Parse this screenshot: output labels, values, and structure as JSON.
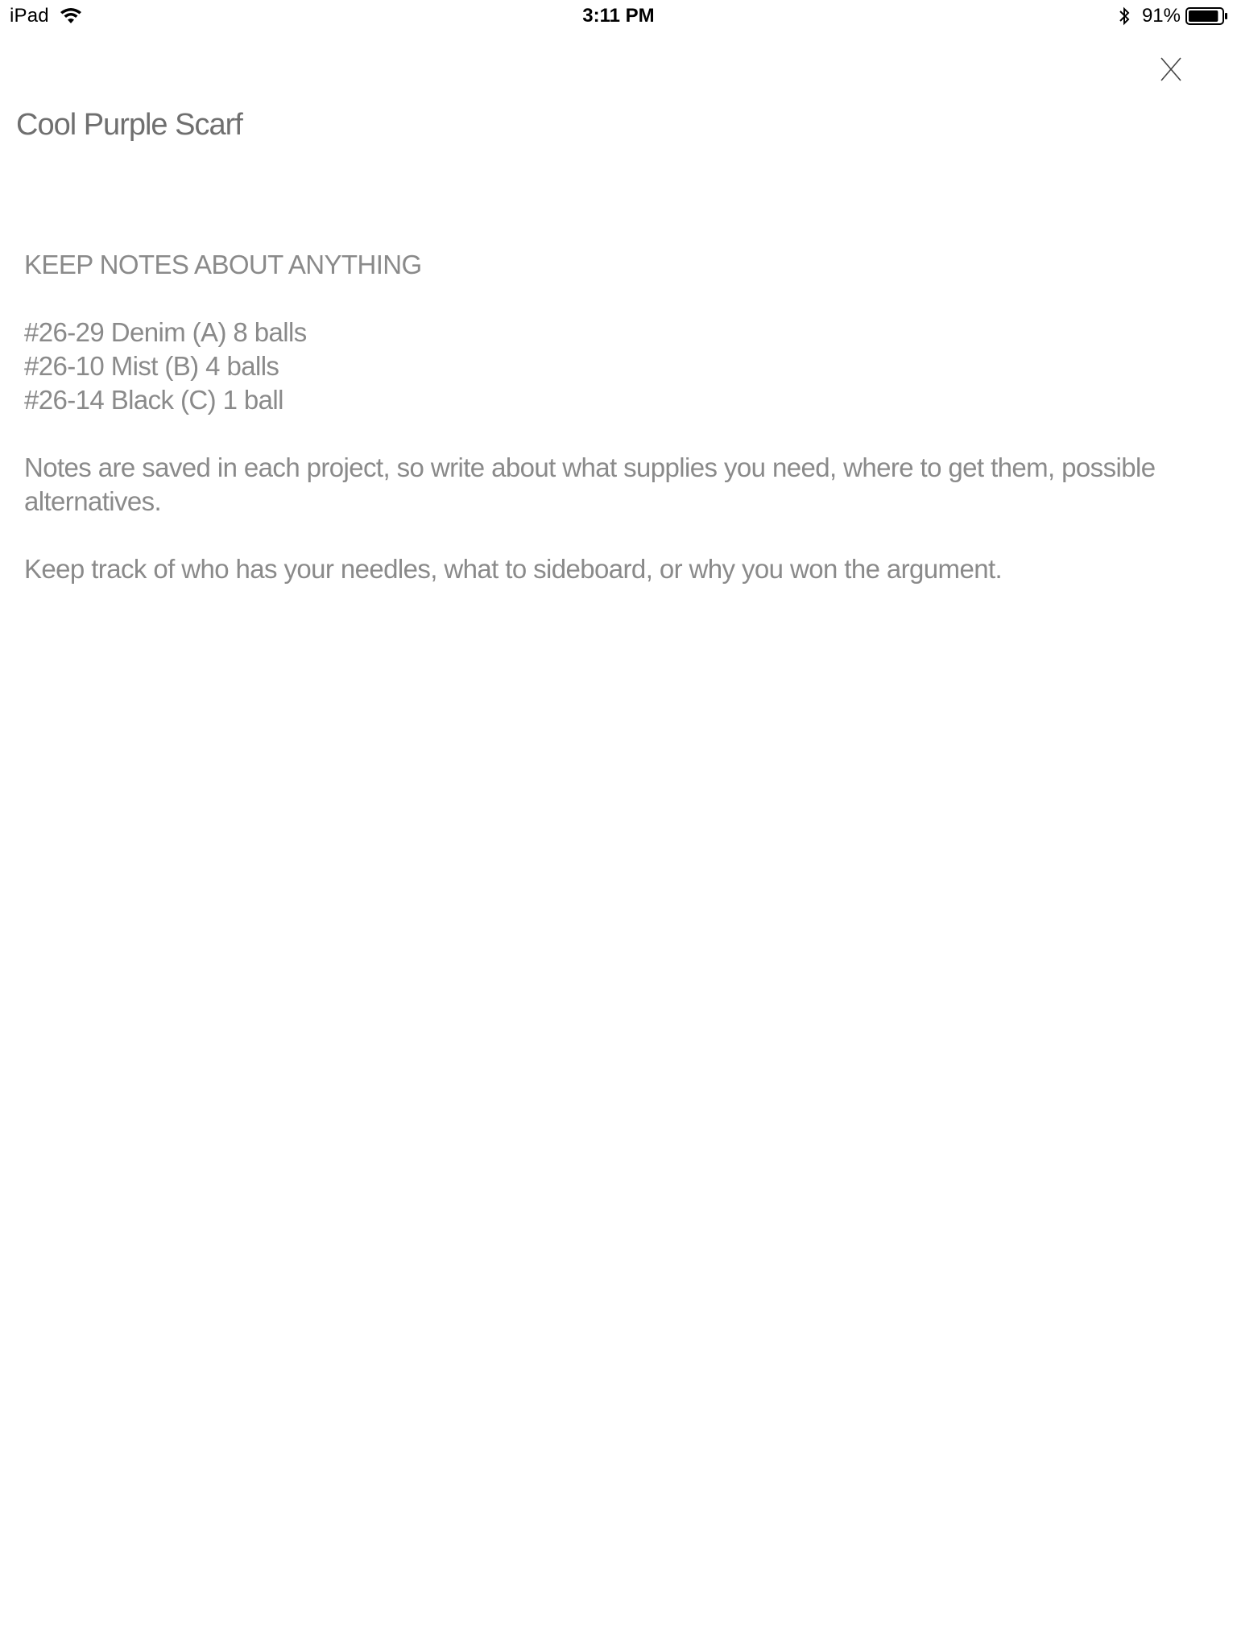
{
  "status_bar": {
    "device": "iPad",
    "time": "3:11 PM",
    "battery": "91%",
    "battery_level": 0.91,
    "icons": [
      "wifi-icon",
      "bluetooth-icon",
      "battery-icon"
    ]
  },
  "close_icon": "close-icon",
  "project": {
    "title": "Cool Purple Scarf"
  },
  "notes": {
    "heading": "KEEP NOTES ABOUT ANYTHING",
    "yarn_lines": [
      "#26-29 Denim (A) 8 balls",
      "#26-10 Mist (B) 4 balls",
      "#26-14 Black (C) 1 ball"
    ],
    "paragraph_1": "Notes are saved in each project, so write about what supplies you need, where to get them, possible alternatives.",
    "paragraph_2": "Keep track of who has your needles, what to sideboard, or why you won the argument."
  },
  "colors": {
    "text_gray": "#8a8a8a",
    "title_gray": "#6f6f6f",
    "background": "#ffffff"
  }
}
